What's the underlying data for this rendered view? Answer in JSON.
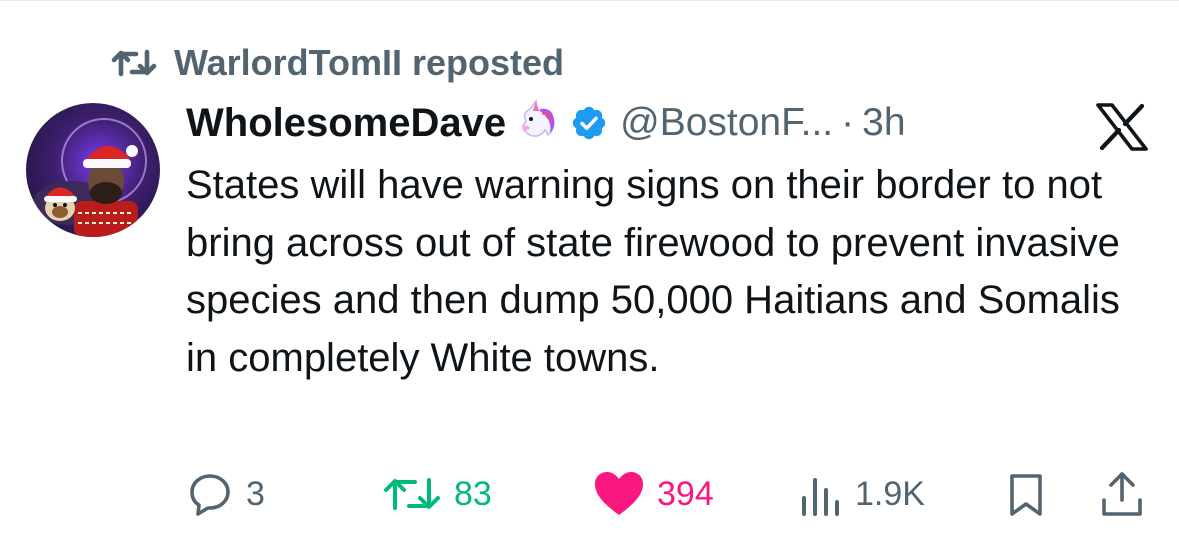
{
  "repost": {
    "label": "WarlordTomII reposted"
  },
  "author": {
    "display_name": "WholesomeDave",
    "handle": "@BostonF...",
    "separator": "·",
    "time": "3h"
  },
  "tweet": {
    "text": "States will have warning signs on their border to not bring across out of state firewood to prevent invasive species and then dump 50,000 Haitians and Somalis in completely White towns."
  },
  "actions": {
    "replies": "3",
    "reposts": "83",
    "likes": "394",
    "views": "1.9K"
  },
  "colors": {
    "secondary_text": "#536471",
    "repost_green": "#00ba7c",
    "like_pink": "#f91880",
    "verified_blue": "#1d9bf0"
  },
  "icons": [
    "repost-icon",
    "unicorn-emoji-icon",
    "verified-badge-icon",
    "x-logo-icon",
    "reply-icon",
    "like-icon",
    "views-icon",
    "bookmark-icon",
    "share-icon"
  ]
}
